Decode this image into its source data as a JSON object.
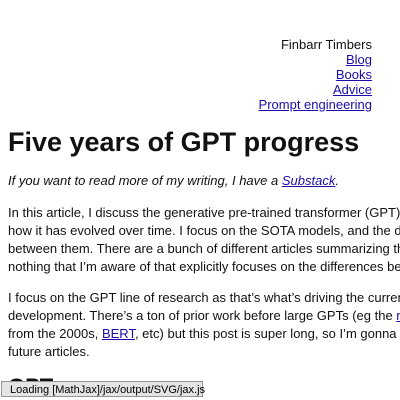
{
  "nav": {
    "author": "Finbarr Timbers",
    "links": [
      "Blog",
      "Books",
      "Advice",
      "Prompt engineering"
    ]
  },
  "post": {
    "title": "Five years of GPT progress",
    "intro_prefix": "If you want to read more of my writing, I have a ",
    "intro_link": "Substack",
    "intro_suffix": ".",
    "p1_lines": [
      "In this article, I discuss the generative pre-trained transformer (GPT)",
      "how it has evolved over time. I focus on the SOTA models, and the d",
      "between them. There are a bunch of different articles summarizing th",
      "nothing that I’m aware of that explicitly focuses on the differences be"
    ],
    "p2_line1_prefix": "I focus on the GPT line of research as that’s what’s driving the curren",
    "p2_line2_prefix": "development. There’s a ton of prior work before large GPTs (eg the ",
    "p2_line2_link": "n",
    "p2_line3_prefix": "from the 2000s, ",
    "p2_line3_link": "BERT",
    "p2_line3_suffix": ", etc) but this post is super long, so I’m gonna",
    "p2_line4": "future articles.",
    "next_heading": "GPT"
  },
  "status": {
    "mathjax": "Loading [MathJax]/jax/output/SVG/jax.js"
  },
  "colors": {
    "link": "#1a0dab",
    "text": "#111111",
    "status_bg": "#e4e4e4"
  }
}
